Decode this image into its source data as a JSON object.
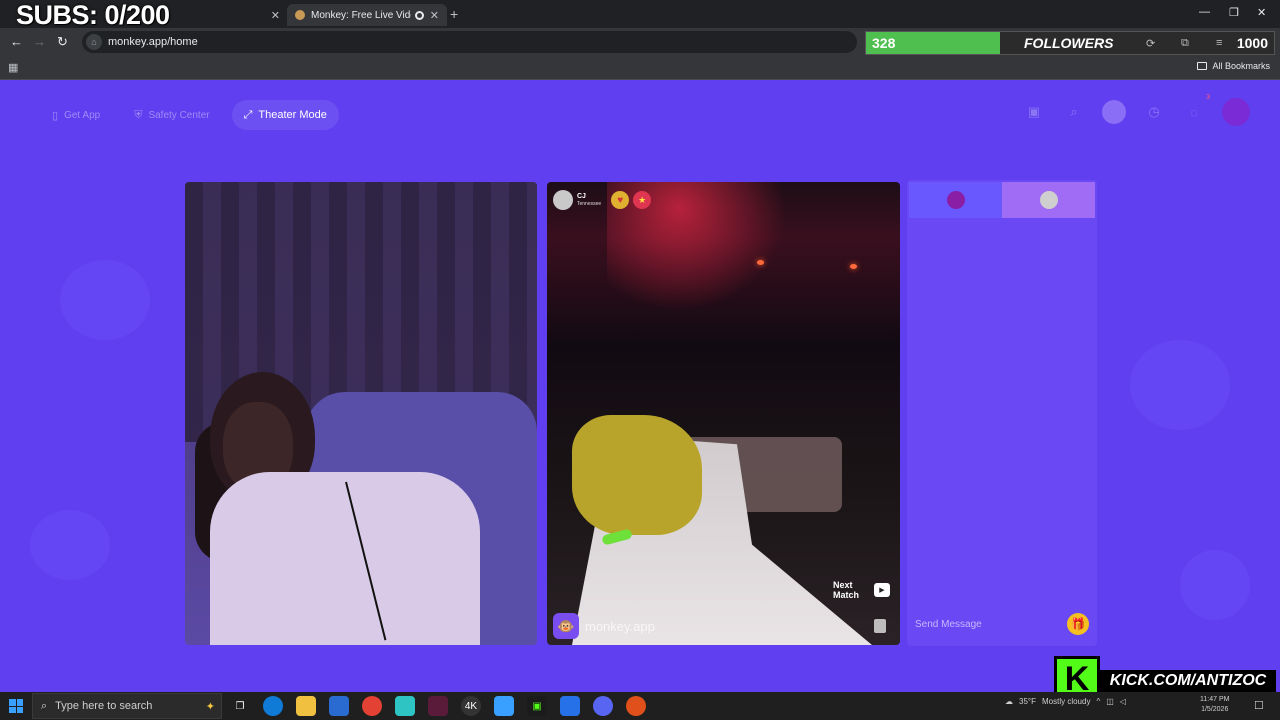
{
  "browser": {
    "tabs": [
      {
        "title": "",
        "close": "✕"
      },
      {
        "title": "Monkey: Free Live Video Ch",
        "close": "✕"
      }
    ],
    "new_tab": "+",
    "address": "monkey.app/home",
    "all_bookmarks": "All Bookmarks"
  },
  "overlay": {
    "subs_text": "SUBS: 0/200",
    "followers_current": "328",
    "followers_label": "FOLLOWERS",
    "followers_goal": "1000",
    "followers_progress": 0.328,
    "kick_url": "KICK.COM/ANTIZOC",
    "kick_logo": "K"
  },
  "site": {
    "nav_left": [
      {
        "label": "Get App",
        "icon": "phone-icon"
      },
      {
        "label": "Safety Center",
        "icon": "shield-icon"
      },
      {
        "label": "Theater Mode",
        "icon": "expand-icon"
      }
    ],
    "notification_badge": "3",
    "match": {
      "name": "CJ",
      "location": "Tennessee"
    },
    "next_match_label_1": "Next",
    "next_match_label_2": "Match",
    "brand_text": "monkey.app",
    "chat_placeholder": "Send Message"
  },
  "taskbar": {
    "search_placeholder": "Type here to search",
    "weather_temp": "35°F",
    "weather_text": "Mostly cloudy",
    "time": "11:47 PM",
    "date": "1/5/2026"
  },
  "colors": {
    "page_bg": "#5f3ff0",
    "chat_bg": "#6a48f4",
    "followers_fill": "#4fbf4f",
    "kick_green": "#53fc18"
  }
}
